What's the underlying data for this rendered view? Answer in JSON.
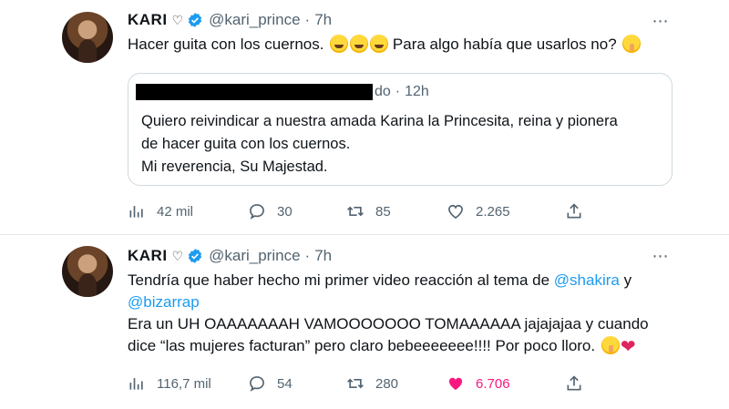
{
  "tweets": [
    {
      "name": "KARI",
      "name_suffix_icon": "heart-outline-icon",
      "handle": "@kari_prince",
      "separator": "·",
      "time": "7h",
      "text_main": "Hacer guita con los cuernos.",
      "text_after_emoji": "Para algo había que usarlos no?",
      "quote": {
        "header_visible_fragment": "do",
        "separator": "·",
        "time": "12h",
        "lines": [
          "Quiero reivindicar a nuestra amada Karina la Princesita, reina y pionera",
          "de hacer guita con los cuernos.",
          "Mi reverencia, Su Majestad."
        ]
      },
      "stats": {
        "views": "42 mil",
        "replies": "30",
        "retweets": "85",
        "likes": "2.265"
      },
      "liked": false
    },
    {
      "name": "KARI",
      "name_suffix_icon": "heart-outline-icon",
      "handle": "@kari_prince",
      "separator": "·",
      "time": "7h",
      "line1_prefix": "Tendría que haber hecho mi primer video reacción al tema de",
      "mention1": "@shakira",
      "line1_suffix": "y",
      "mention2": "@bizarrap",
      "line3": "Era un UH OAAAAAAAH VAMOOOOOOO TOMAAAAAA jajajajaa y cuando",
      "line4": "dice “las mujeres facturan” pero claro bebeeeeeee!!!! Por poco lloro.",
      "stats": {
        "views": "116,7 mil",
        "replies": "54",
        "retweets": "280",
        "likes": "6.706"
      },
      "liked": true
    }
  ],
  "colors": {
    "accent": "#1d9bf0",
    "like": "#f91880",
    "muted": "#536471",
    "border": "#cfd9de"
  }
}
